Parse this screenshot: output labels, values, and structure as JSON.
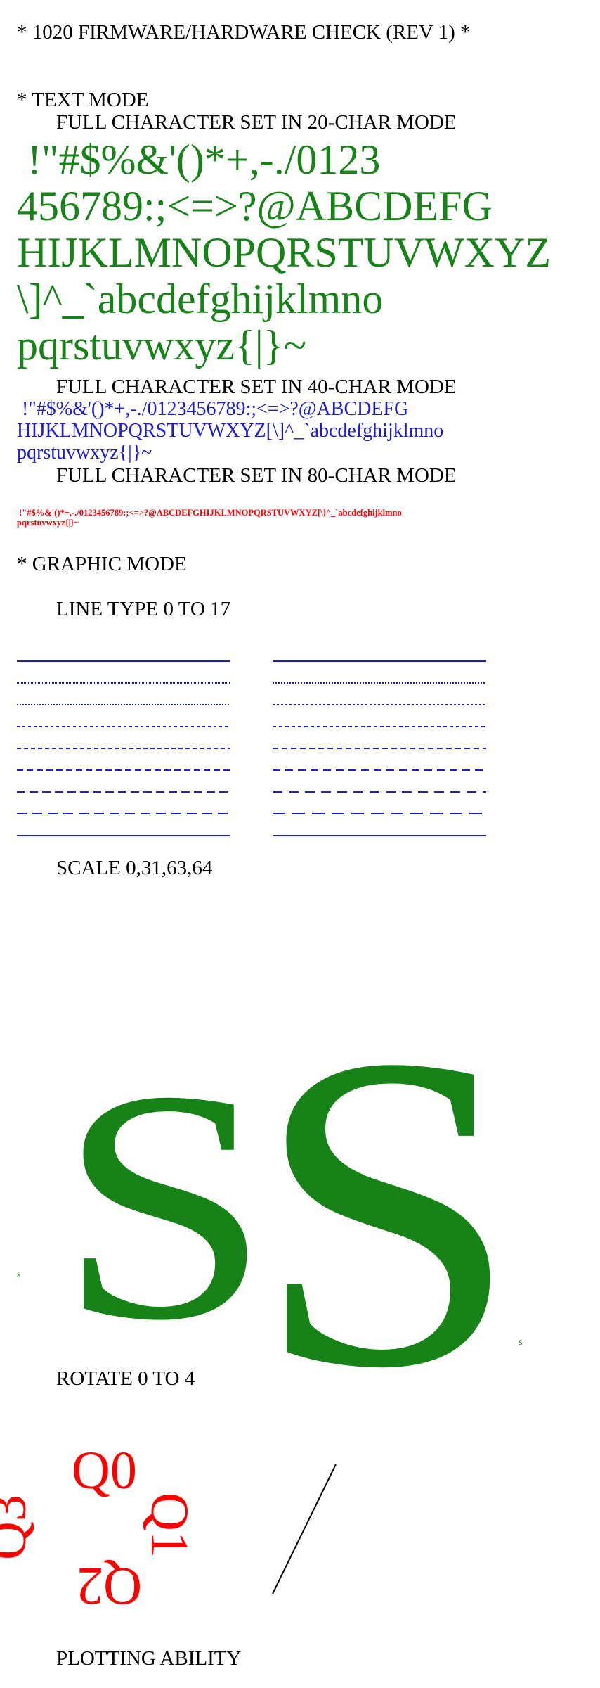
{
  "title": "* 1020 FIRMWARE/HARDWARE CHECK (REV 1) *",
  "text_mode": {
    "heading": "* TEXT MODE",
    "mode20_label": "FULL CHARACTER SET IN 20-CHAR MODE",
    "mode20_lines": [
      " !\"#$%&'()*+,-./0123",
      "456789:;<=>?@ABCDEFG",
      "HIJKLMNOPQRSTUVWXYZ",
      "\\]^_`abcdefghijklmno",
      "pqrstuvwxyz{|}~"
    ],
    "mode40_label": "FULL CHARACTER SET IN 40-CHAR MODE",
    "mode40_lines": [
      " !\"#$%&'()*+,-./0123456789:;<=>?@ABCDEFG",
      "HIJKLMNOPQRSTUVWXYZ[\\]^_`abcdefghijklmno",
      "pqrstuvwxyz{|}~"
    ],
    "mode80_label": "FULL CHARACTER SET IN 80-CHAR MODE",
    "mode80_lines": [
      " !\"#$%&'()*+,-./0123456789:;<=>?@ABCDEFGHIJKLMNOPQRSTUVWXYZ[\\]^_`abcdefghijklmno",
      "pqrstuvwxyz{|}~"
    ]
  },
  "graphic_mode": {
    "heading": "* GRAPHIC MODE",
    "line_type_label": "LINE TYPE 0 TO 17",
    "line_color": "#1c1cd0",
    "scale_label": "SCALE 0,31,63,64",
    "scale_letters": [
      "s",
      "S",
      "S",
      "s"
    ],
    "scale_color": "#178217",
    "rotate_label": "ROTATE 0 TO 4",
    "rotate_glyphs": [
      "Q0",
      "Q1",
      "Q2",
      "Q3"
    ],
    "rotate_color": "#ff0000",
    "plotting_label": "PLOTTING ABILITY"
  }
}
